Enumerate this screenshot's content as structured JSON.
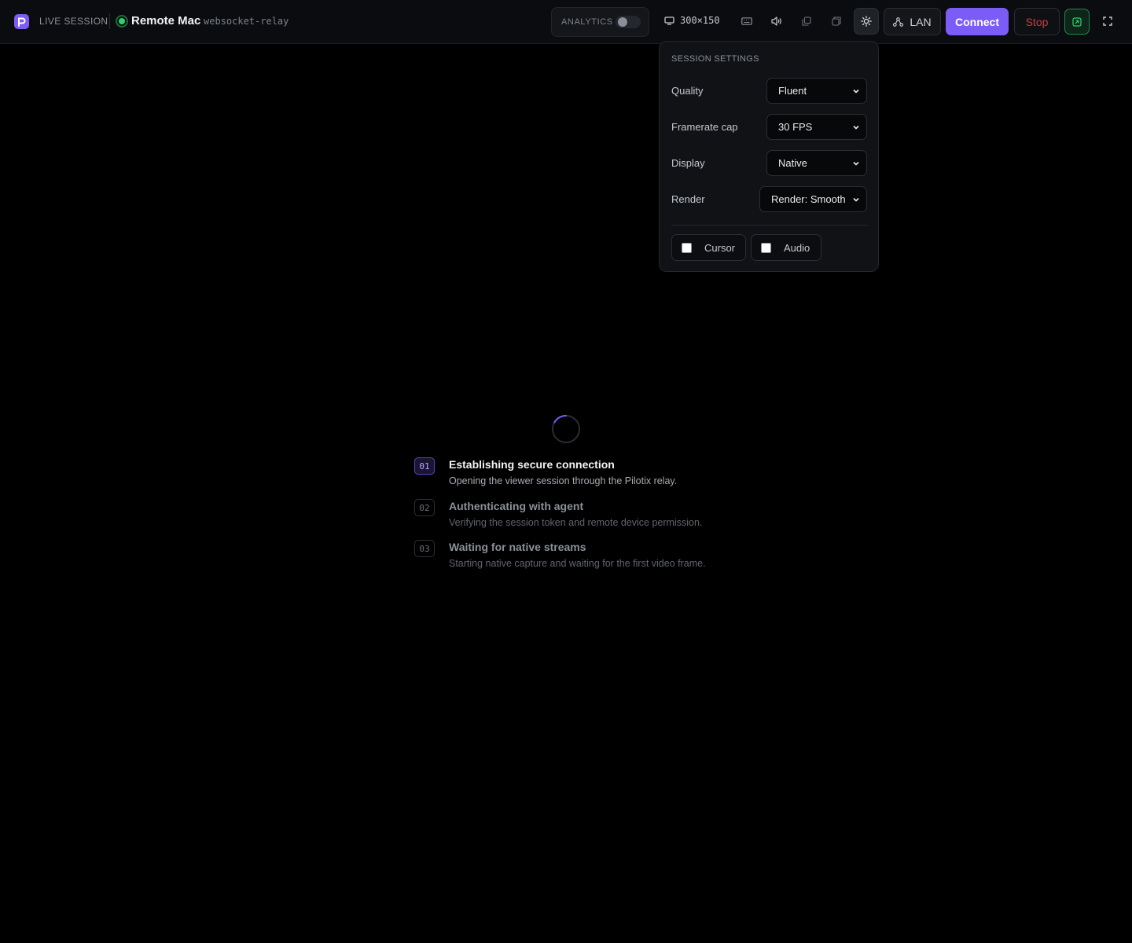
{
  "header": {
    "section_label": "LIVE SESSION",
    "host_name": "Remote Mac",
    "transport": "websocket-relay",
    "analytics_label": "ANALYTICS",
    "analytics_enabled": false,
    "resolution": "300×150",
    "network_label": "LAN",
    "connect_label": "Connect",
    "stop_label": "Stop"
  },
  "settings": {
    "title": "SESSION SETTINGS",
    "rows": [
      {
        "label": "Quality",
        "value": "Fluent"
      },
      {
        "label": "Framerate cap",
        "value": "30 FPS"
      },
      {
        "label": "Display",
        "value": "Native"
      },
      {
        "label": "Render",
        "value": "Render: Smooth"
      }
    ],
    "checks": [
      {
        "label": "Cursor",
        "checked": false
      },
      {
        "label": "Audio",
        "checked": false
      }
    ]
  },
  "steps": [
    {
      "num": "01",
      "title": "Establishing secure connection",
      "desc": "Opening the viewer session through the Pilotix relay."
    },
    {
      "num": "02",
      "title": "Authenticating with agent",
      "desc": "Verifying the session token and remote device permission."
    },
    {
      "num": "03",
      "title": "Waiting for native streams",
      "desc": "Starting native capture and waiting for the first video frame."
    }
  ],
  "colors": {
    "accent": "#7c5cf7",
    "status_online": "#2fd16f",
    "stop": "#c2403f",
    "background": "#000000"
  }
}
